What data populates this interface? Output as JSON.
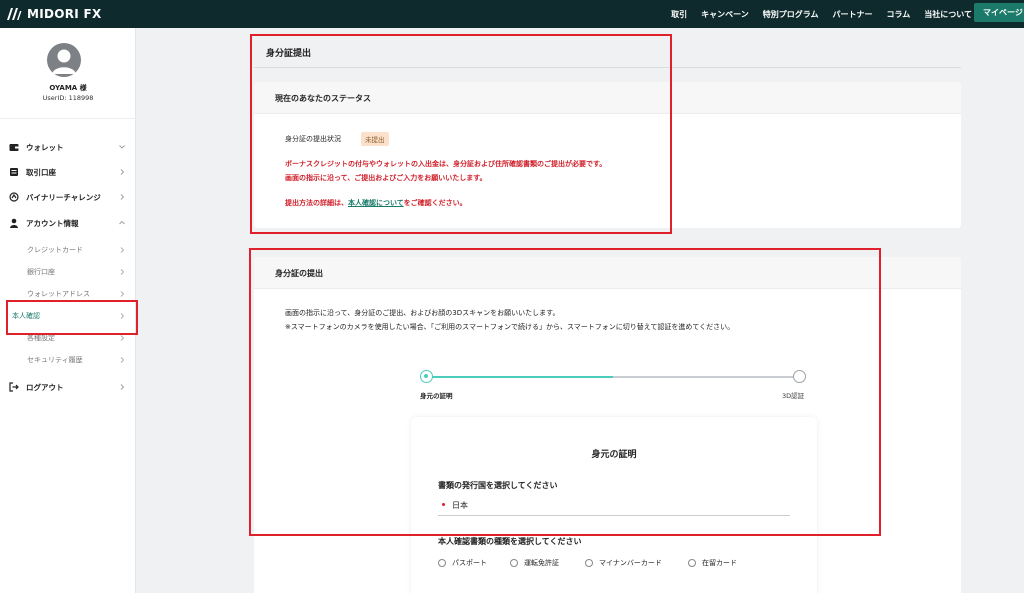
{
  "header": {
    "logo_text": "MIDORI FX",
    "nav": [
      "取引",
      "キャンペーン",
      "特別プログラム",
      "パートナー",
      "コラム",
      "当社について"
    ],
    "mypage_label": "マイページ"
  },
  "sidebar": {
    "user_name": "OYAMA 様",
    "user_id": "UserID: 118998",
    "items": [
      {
        "label": "ウォレット",
        "icon": "wallet-icon"
      },
      {
        "label": "取引口座",
        "icon": "bank-icon"
      },
      {
        "label": "バイナリーチャレンジ",
        "icon": "binary-icon"
      },
      {
        "label": "アカウント情報",
        "icon": "user-icon"
      }
    ],
    "sub_items": [
      "クレジットカード",
      "銀行口座",
      "ウォレットアドレス",
      "本人確認",
      "各種設定",
      "セキュリティ履歴"
    ],
    "logout_label": "ログアウト"
  },
  "main": {
    "page_title": "身分証提出",
    "status_card": {
      "heading": "現在のあなたのステータス",
      "status_label": "身分証の提出状況",
      "status_badge": "未提出",
      "notice_line1": "ボーナスクレジットの付与やウォレットの入出金は、身分証および住所確認書類のご提出が必要です。",
      "notice_line2": "画面の指示に沿って、ご提出およびご入力をお願いいたします。",
      "detail_prefix": "提出方法の詳細は、",
      "detail_link": "本人確認について",
      "detail_suffix": "をご確認ください。"
    },
    "submit_card": {
      "heading": "身分証の提出",
      "instr_line1": "画面の指示に沿って、身分証のご提出、およびお顔の3Dスキャンをお願いいたします。",
      "instr_line2": "※スマートフォンのカメラを使用したい場合、「ご利用のスマートフォンで続ける」から、スマートフォンに切り替えて認証を進めてください。",
      "steps": [
        "身元の証明",
        "3D認証"
      ],
      "step_progress": 0.5,
      "form": {
        "title": "身元の証明",
        "country_label": "書類の発行国を選択してください",
        "country_value": "日本",
        "doc_type_label": "本人確認書類の種類を選択してください",
        "doc_options": [
          "パスポート",
          "運転免許証",
          "マイナンバーカード",
          "在留カード"
        ]
      }
    }
  },
  "colors": {
    "topbar": "#0f2a2c",
    "accent": "#1b7a6a",
    "stepper": "#4ccdbb",
    "highlight": "#e0202a",
    "warning_text": "#d0202a"
  }
}
